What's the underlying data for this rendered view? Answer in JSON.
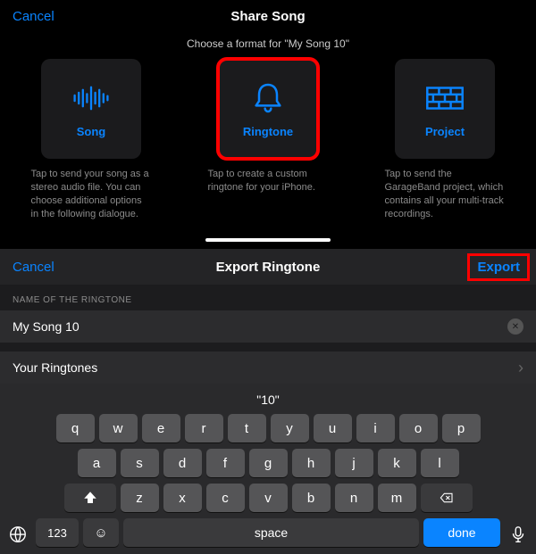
{
  "top": {
    "cancel": "Cancel",
    "title": "Share Song",
    "subtitle": "Choose a format for \"My Song 10\"",
    "options": [
      {
        "label": "Song",
        "desc": "Tap to send your song as a stereo audio file. You can choose additional options in the following dialogue."
      },
      {
        "label": "Ringtone",
        "desc": "Tap to create a custom ringtone for your iPhone."
      },
      {
        "label": "Project",
        "desc": "Tap to send the GarageBand project, which contains all your multi-track recordings."
      }
    ]
  },
  "bottom": {
    "cancel": "Cancel",
    "title": "Export Ringtone",
    "export": "Export",
    "section_label": "NAME OF THE RINGTONE",
    "name_value": "My Song 10",
    "your_ringtones": "Your Ringtones"
  },
  "keyboard": {
    "suggestion": "\"10\"",
    "row1": [
      "q",
      "w",
      "e",
      "r",
      "t",
      "y",
      "u",
      "i",
      "o",
      "p"
    ],
    "row2": [
      "a",
      "s",
      "d",
      "f",
      "g",
      "h",
      "j",
      "k",
      "l"
    ],
    "row3": [
      "z",
      "x",
      "c",
      "v",
      "b",
      "n",
      "m"
    ],
    "numbers": "123",
    "space": "space",
    "done": "done"
  }
}
